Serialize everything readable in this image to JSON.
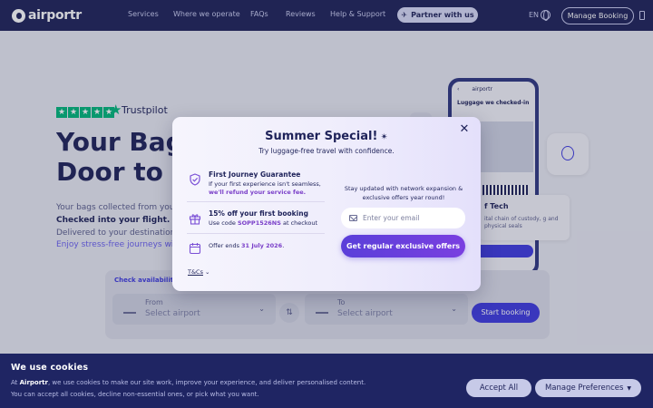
{
  "nav": {
    "logo_text": "airportr",
    "links": [
      "Services",
      "Where we operate",
      "FAQs",
      "Reviews",
      "Help & Support"
    ],
    "partner_label": "Partner with us",
    "language": "EN",
    "manage_booking": "Manage Booking"
  },
  "hero": {
    "trustpilot": "Trustpilot",
    "title_line1": "Your Bags",
    "title_line2": "Door to D",
    "line1": "Your bags collected from your",
    "line2": "Checked into your flight.",
    "line3": "Delivered to your destination.",
    "line4": "Enjoy stress-free journeys with"
  },
  "phone": {
    "app_name": "airportr",
    "heading": "Luggage we checked-in"
  },
  "side_card": {
    "title": "f Tech",
    "text": "ital chain of custody, g and physical seals"
  },
  "booking": {
    "tab": "Check availability",
    "from_label": "From",
    "from_placeholder": "Select airport",
    "to_label": "To",
    "to_placeholder": "Select airport",
    "start_button": "Start booking"
  },
  "modal": {
    "title": "Summer Special!",
    "sparkle": "✴",
    "subtitle": "Try luggage-free travel with confidence.",
    "features": [
      {
        "title": "First Journey Guarantee",
        "desc1": "If your first experience isn't seamless,",
        "desc2": "we'll refund your service fee."
      },
      {
        "title": "15% off your first booking",
        "desc_prefix": "Use code ",
        "code": "SOPP1526NS",
        "desc_suffix": " at checkout"
      },
      {
        "desc_prefix": "Offer ends ",
        "date": "31 July 2026",
        "desc_suffix": "."
      }
    ],
    "tc_label": "T&Cs",
    "right_copy": "Stay updated with network expansion & exclusive offers year round!",
    "email_placeholder": "Enter your email",
    "cta": "Get regular exclusive offers",
    "accent_color": "#7a3fc8"
  },
  "cookie": {
    "title": "We use cookies",
    "text1_prefix": "At ",
    "text1_brand": "Airportr",
    "text1_suffix": ", we use cookies to make our site work, improve your experience, and deliver personalised content.",
    "text2": "You can accept all cookies, decline non-essential ones, or pick what you want.",
    "accept": "Accept All",
    "manage": "Manage Preferences"
  }
}
